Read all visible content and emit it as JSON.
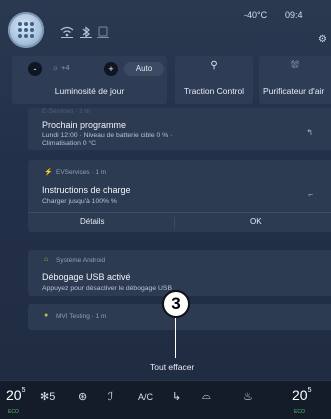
{
  "status_bar": {
    "outside_temp": "-40°C",
    "clock": "09:4"
  },
  "quick_settings": {
    "brightness": {
      "minus_label": "-",
      "level_label": "☼ +4",
      "plus_label": "+",
      "auto_label": "Auto",
      "label": "Luminosité de jour"
    },
    "traction": {
      "label": "Traction Control"
    },
    "purifier": {
      "label": "Purificateur d'air"
    }
  },
  "notifications": [
    {
      "source": "E-Services · 1 m",
      "title": "Prochain programme",
      "line1": "Lundi 12:00 · Niveau de batterie cible 0 % ·",
      "line2": "Climatisation 0 °C"
    },
    {
      "source": "EVServices · 1 m",
      "title": "Instructions de charge",
      "line1": "Charger jusqu'à 100% %",
      "actions": [
        "Détails",
        "OK"
      ]
    },
    {
      "source": "Système Android",
      "title": "Débogage USB activé",
      "line1": "Appuyez pour désactiver le débogage USB"
    },
    {
      "source": "MVI Testing · 1 m"
    }
  ],
  "callout_number": "3",
  "clear_all_label": "Tout effacer",
  "bottom_bar": {
    "left_temp": "20",
    "left_temp_unit": "5",
    "left_eco": "ECO",
    "fan_level": "5",
    "ac_label": "A/C",
    "right_temp": "20",
    "right_temp_unit": "5",
    "right_eco": "ECO"
  },
  "colors": {
    "background": "#23304a",
    "card": "#2c3a52",
    "bottom_bar": "#141c2a",
    "eco_green": "#53c06b"
  }
}
